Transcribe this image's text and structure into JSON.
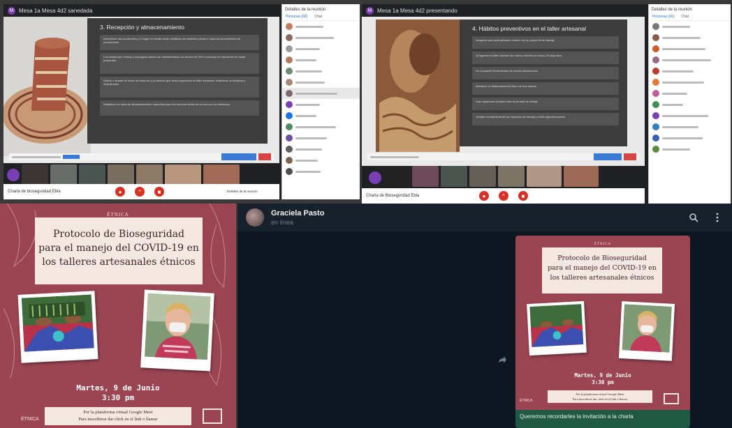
{
  "meet1": {
    "title": "Mesa 1a Mesa 4d2 sanedada",
    "slide_title": "3. Recepción y almacenamiento",
    "bullets": [
      "Determinar las condiciones y el lugar en donde serán recibidas las materias primas e insumos provenientes de proveedores",
      "Los recipientes, bolsas y empaques deben ser desinfectados con alcohol al 70% o solución de hipoclorito de sodio preparada",
      "Retirar e lavado de todos los insumos y productos que sean ingresados al taller artesanal, realizando su limpieza y desinfección",
      "Establecer un área de almacenamiento específica para los insumos antes de su uso por los artesanos"
    ],
    "bottom_left": "Charla de bioseguridad Ebla",
    "present_label": "Detalles de la reunión",
    "side_title": "Detalles de la reunión",
    "side_tab1": "Personas (66)",
    "side_tab2": "Chat"
  },
  "meet2": {
    "title": "Mesa 1a Mesa 4d2 presentando",
    "slide_title": "4. Hábitos preventivos en el taller artesanal",
    "bullets": [
      "Asegurar que cada artesano cuente con su propio kit de trabajo",
      "Al ingresar al taller, lavarse las manos durante al menos 20 segundos",
      "No compartir herramientas sin previa desinfección",
      "Mantener el distanciamiento físico de dos metros",
      "Usar tapabocas durante toda la jornada de trabajo",
      "Ventilar constantemente los espacios de trabajo y evitar aglomeraciones"
    ],
    "bottom_left": "Charla de Bioseguridad Ebla",
    "side_title": "Detalles de la reunión",
    "side_tab1": "Personas (66)",
    "side_tab2": "Chat"
  },
  "flyer": {
    "brand": "ÉTNICA",
    "title_lines": [
      "Protocolo de Bioseguridad",
      "para el manejo del COVID-19 en",
      "los talleres artesanales étnicos"
    ],
    "date_line": "Martes, 9 de Junio",
    "time_line": "3:30 pm",
    "info_line1": "Por la plataforma virtual Google Meet",
    "info_line2": "Para inscribirse dar click en el link o llamar",
    "footer_brand": "ÉTNICA"
  },
  "telegram": {
    "contact_name": "Graciela Pasto",
    "status": "en línea",
    "caption": "Queremos recordarles la invitación a la charla",
    "search_icon": "search-icon",
    "menu_icon": "more-vert-icon"
  },
  "colors": {
    "flyer_bg": "#9b4552",
    "flyer_cream": "#f5e8e1",
    "meet_dark": "#202124",
    "telegram_bg": "#0e1621",
    "telegram_bubble": "#1f5944"
  }
}
